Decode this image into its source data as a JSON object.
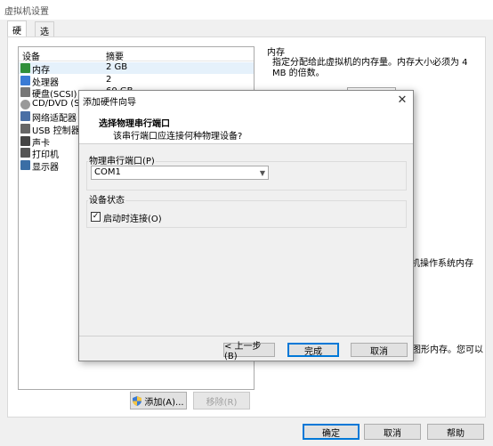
{
  "window": {
    "title": "虚拟机设置"
  },
  "tabs": [
    {
      "label": "硬件"
    },
    {
      "label": "选项"
    }
  ],
  "device_list": {
    "headers": {
      "device": "设备",
      "summary": "摘要"
    },
    "rows": [
      {
        "name": "内存",
        "value": "2 GB",
        "icon": "memory-icon"
      },
      {
        "name": "处理器",
        "value": "2",
        "icon": "cpu-icon"
      },
      {
        "name": "硬盘(SCSI)",
        "value": "60 GB",
        "icon": "hard-disk-icon"
      },
      {
        "name": "CD/DVD (SATA)",
        "value": "",
        "icon": "cd-dvd-icon"
      },
      {
        "name": "网络适配器",
        "value": "",
        "icon": "network-adapter-icon"
      },
      {
        "name": "USB 控制器",
        "value": "",
        "icon": "usb-icon"
      },
      {
        "name": "声卡",
        "value": "",
        "icon": "sound-card-icon"
      },
      {
        "name": "打印机",
        "value": "",
        "icon": "printer-icon"
      },
      {
        "name": "显示器",
        "value": "",
        "icon": "display-icon"
      }
    ]
  },
  "memory_panel": {
    "title": "内存",
    "description": "指定分配给此虚拟机的内存量。内存大小必须为 4 MB 的倍数。",
    "partial_text_1": "机操作系统内存",
    "partial_text_2": "图形内存。您可以"
  },
  "bottom_buttons": {
    "add": "添加(A)...",
    "remove": "移除(R)",
    "ok": "确定",
    "cancel": "取消",
    "help": "帮助"
  },
  "dialog": {
    "title": "添加硬件向导",
    "heading": "选择物理串行端口",
    "subheading": "该串行端口应连接何种物理设备?",
    "port_group_label": "物理串行端口(P)",
    "port_selected": "COM1",
    "status_group_label": "设备状态",
    "connect_label": "启动时连接(O)",
    "connect_checked": true,
    "buttons": {
      "back": "< 上一步(B)",
      "finish": "完成",
      "cancel": "取消"
    }
  }
}
